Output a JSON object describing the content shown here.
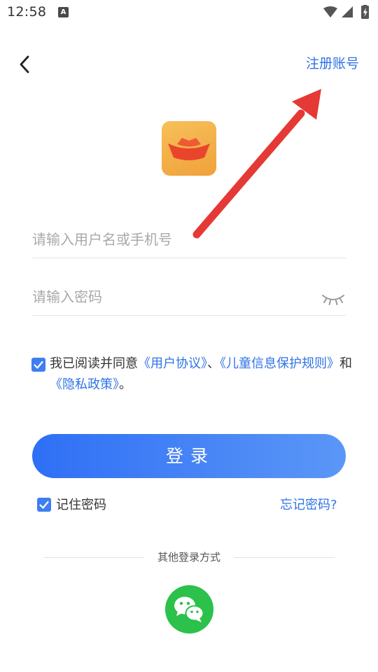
{
  "status_bar": {
    "time": "12:58",
    "notification_icon": "a-badge-icon",
    "icons": [
      "wifi-icon",
      "signal-icon",
      "battery-charging-icon"
    ]
  },
  "header": {
    "back_icon": "chevron-left-icon",
    "register_label": "注册账号"
  },
  "logo": {
    "icon": "boat-logo-icon",
    "colors": {
      "background": "#f3ad45",
      "boat": "#e8452c"
    }
  },
  "form": {
    "username_placeholder": "请输入用户名或手机号",
    "password_placeholder": "请输入密码",
    "password_toggle_icon": "eye-closed-icon"
  },
  "agreement": {
    "checked": true,
    "prefix": "我已阅读并同意",
    "user_agreement": "《用户协议》",
    "separator": "、",
    "children_rules": "《儿童信息保护规则》",
    "and": "和",
    "privacy_policy": "《隐私政策》",
    "suffix": "。"
  },
  "login_button": {
    "label": "登录"
  },
  "remember": {
    "checked": true,
    "label": "记住密码"
  },
  "forgot_label": "忘记密码?",
  "other_login": {
    "label": "其他登录方式",
    "wechat_icon": "wechat-icon"
  },
  "colors": {
    "accent": "#2f73e6",
    "button_start": "#2f6ff5",
    "button_end": "#5b97f7",
    "wechat": "#2bc14a",
    "annotation_arrow": "#e53935"
  }
}
